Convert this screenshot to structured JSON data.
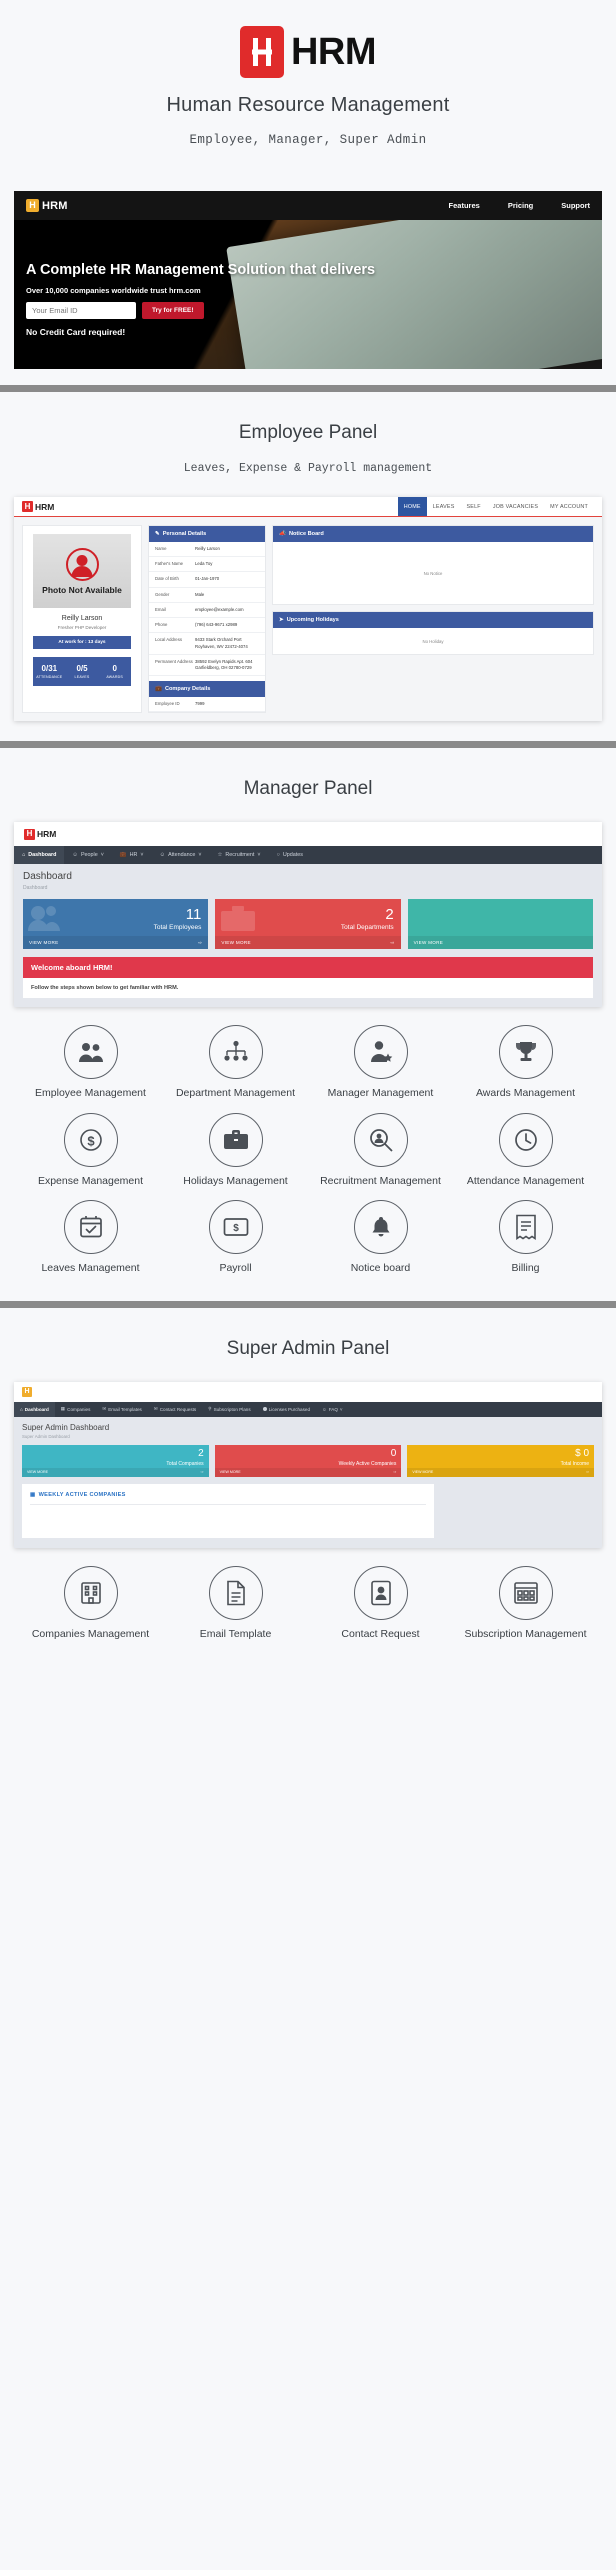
{
  "brand": {
    "mark_letter": "H",
    "word": "HRM",
    "title": "Human Resource Management",
    "subtitle": "Employee, Manager, Super Admin"
  },
  "landing": {
    "nav": {
      "brand_letter": "H",
      "brand_word": "HRM",
      "links": [
        "Features",
        "Pricing",
        "Support"
      ]
    },
    "headline": "A Complete HR Management Solution that delivers",
    "subheadline": "Over 10,000 companies worldwide trust hrm.com",
    "email_placeholder": "Your Email ID",
    "cta_label": "Try for FREE!",
    "note": "No Credit Card required!"
  },
  "employee_section": {
    "title": "Employee Panel",
    "subtitle": "Leaves, Expense & Payroll management",
    "app": {
      "brand_letter": "H",
      "brand_word": "HRM",
      "menu": [
        "HOME",
        "LEAVES",
        "SELF",
        "JOB VACANCIES",
        "MY ACCOUNT"
      ],
      "active_menu": "HOME",
      "photo_placeholder": "Photo Not Available",
      "employee_name": "Reilly Larson",
      "employee_role": "Fresher PHP Developer",
      "at_work": "At work for : 13 days",
      "stats": [
        {
          "value": "0/31",
          "label": "ATTENDANCE"
        },
        {
          "value": "0/5",
          "label": "LEAVES"
        },
        {
          "value": "0",
          "label": "AWARDS"
        }
      ],
      "personal_details_title": "Personal Details",
      "personal_details": [
        {
          "key": "Name",
          "value": "Reilly Larson"
        },
        {
          "key": "Father's Name",
          "value": "Leda Toy"
        },
        {
          "key": "Date of Birth",
          "value": "01-Jan-1970"
        },
        {
          "key": "Gender",
          "value": "Male"
        },
        {
          "key": "Email",
          "value": "employee@example.com"
        },
        {
          "key": "Phone",
          "value": "(796) 643-9671 x2989"
        },
        {
          "key": "Local Address",
          "value": "9433 Stark Orchard Port Royhaven, WV 22472-4074"
        },
        {
          "key": "Permanent Address",
          "value": "38592 Evelyn Rapids Apt. 604 Garfieldberg, OH 02780-0729"
        }
      ],
      "company_details_title": "Company Details",
      "company_details": [
        {
          "key": "Employee ID",
          "value": "7999"
        }
      ],
      "notice_board_title": "Notice Board",
      "notice_board_empty": "No Notice",
      "upcoming_holidays_title": "Upcoming Holidays",
      "upcoming_holidays_empty": "No Holiday"
    }
  },
  "manager_section": {
    "title": "Manager Panel",
    "app": {
      "brand_letter": "H",
      "brand_word": "HRM",
      "menu": [
        "Dashboard",
        "People",
        "HR",
        "Attendance",
        "Recruitment",
        "Updates"
      ],
      "active_menu": "Dashboard",
      "page_title": "Dashboard",
      "breadcrumb": "Dashboard",
      "cards": [
        {
          "value": "11",
          "label": "Total Employees",
          "more": "VIEW MORE",
          "color": "#3e76ab"
        },
        {
          "value": "2",
          "label": "Total Departments",
          "more": "VIEW MORE",
          "color": "#e04c4c"
        },
        {
          "value": "",
          "label": "",
          "more": "VIEW MORE",
          "color": "#3fb6a8"
        }
      ],
      "welcome_title": "Welcome aboard HRM!",
      "welcome_body": "Follow the steps shown below to get familiar with HRM."
    },
    "features": [
      {
        "icon": "people-icon",
        "label": "Employee Management"
      },
      {
        "icon": "sitemap-icon",
        "label": "Department Management"
      },
      {
        "icon": "manager-star-icon",
        "label": "Manager Management"
      },
      {
        "icon": "trophy-icon",
        "label": "Awards Management"
      },
      {
        "icon": "dollar-circle-icon",
        "label": "Expense Management"
      },
      {
        "icon": "suitcase-icon",
        "label": "Holidays Management"
      },
      {
        "icon": "magnifier-person-icon",
        "label": "Recruitment Management"
      },
      {
        "icon": "clock-icon",
        "label": "Attendance Management"
      },
      {
        "icon": "calendar-check-icon",
        "label": "Leaves Management"
      },
      {
        "icon": "money-bill-icon",
        "label": "Payroll"
      },
      {
        "icon": "bell-icon",
        "label": "Notice board"
      },
      {
        "icon": "receipt-icon",
        "label": "Billing"
      }
    ]
  },
  "superadmin_section": {
    "title": "Super Admin Panel",
    "app": {
      "brand_letter": "H",
      "menu": [
        "Dashboard",
        "Companies",
        "Email Templates",
        "Contact Requests",
        "Subscripton Plans",
        "Licenses Purchased",
        "FAQ"
      ],
      "active_menu": "Dashboard",
      "page_title": "Super Admin Dashboard",
      "breadcrumb": "Super Admin Dashboard",
      "cards": [
        {
          "value": "2",
          "label": "Total Companies",
          "more": "VIEW MORE",
          "color": "#3fb6c4"
        },
        {
          "value": "0",
          "label": "Weekly Active Companies",
          "more": "VIEW MORE",
          "color": "#e04c4c"
        },
        {
          "value": "$ 0",
          "label": "Total Income",
          "more": "VIEW MORE",
          "color": "#edb212"
        }
      ],
      "widget_title": "WEEKLY ACTIVE COMPANIES"
    },
    "features": [
      {
        "icon": "building-icon",
        "label": "Companies Management"
      },
      {
        "icon": "document-icon",
        "label": "Email Template"
      },
      {
        "icon": "contact-person-icon",
        "label": "Contact Request"
      },
      {
        "icon": "grid-box-icon",
        "label": "Subscription Management"
      }
    ]
  },
  "colors": {
    "brand_red": "#e02b2b",
    "brand_amber": "#f0ad2e",
    "panel_blue": "#3d5aa0",
    "nav_dark": "#343c47"
  }
}
